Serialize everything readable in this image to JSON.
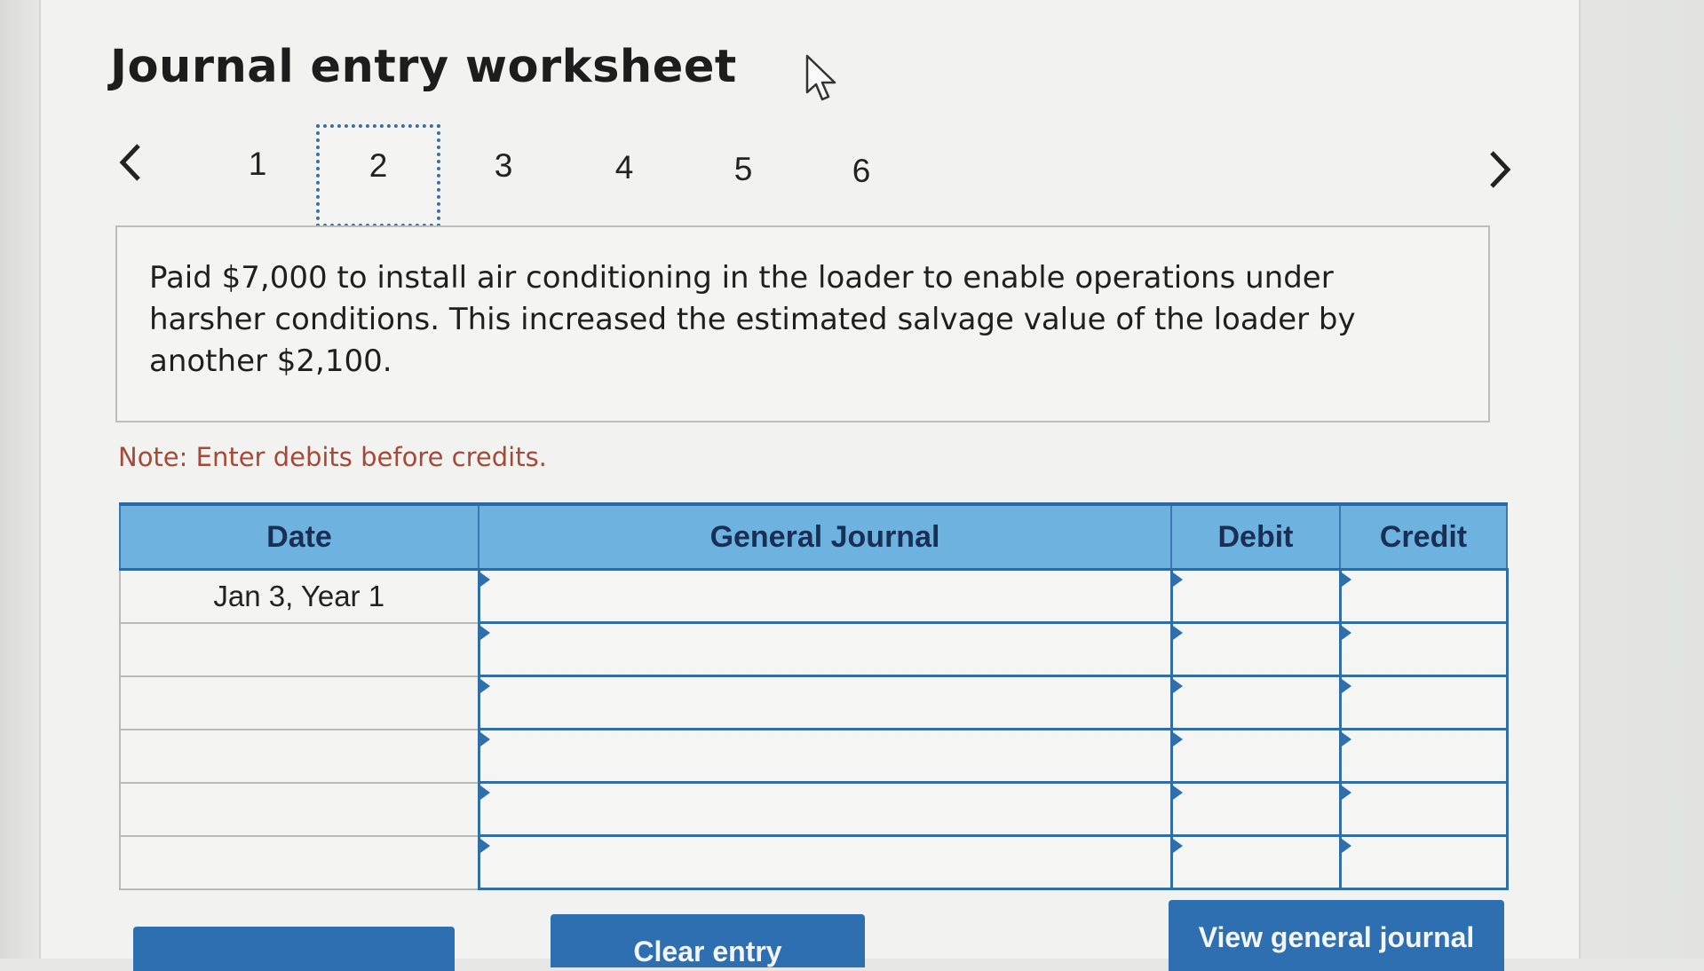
{
  "header": {
    "title": "Journal entry worksheet"
  },
  "pagination": {
    "prev_icon": "chevron-left-icon",
    "next_icon": "chevron-right-icon",
    "steps": [
      "1",
      "2",
      "3",
      "4",
      "5",
      "6"
    ],
    "active_step": "2"
  },
  "description": {
    "text": "Paid $7,000 to install air conditioning in the loader to enable operations under harsher conditions. This increased the estimated salvage value of the loader by another $2,100."
  },
  "note": "Note: Enter debits before credits.",
  "table": {
    "headers": {
      "date": "Date",
      "general_journal": "General Journal",
      "debit": "Debit",
      "credit": "Credit"
    },
    "rows": [
      {
        "date": "Jan 3, Year 1",
        "account": "",
        "debit": "",
        "credit": ""
      },
      {
        "date": "",
        "account": "",
        "debit": "",
        "credit": ""
      },
      {
        "date": "",
        "account": "",
        "debit": "",
        "credit": ""
      },
      {
        "date": "",
        "account": "",
        "debit": "",
        "credit": ""
      },
      {
        "date": "",
        "account": "",
        "debit": "",
        "credit": ""
      },
      {
        "date": "",
        "account": "",
        "debit": "",
        "credit": ""
      }
    ]
  },
  "buttons": {
    "clear_entry": "Clear entry",
    "view_general_journal": "View general journal"
  },
  "colors": {
    "header_bg": "#6eb3e0",
    "accent": "#2d6fb0",
    "note_text": "#a54a38"
  }
}
